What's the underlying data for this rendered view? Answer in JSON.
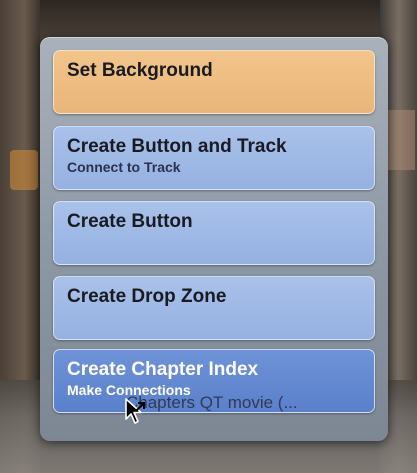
{
  "menu": {
    "items": [
      {
        "title": "Set Background",
        "subtitle": ""
      },
      {
        "title": "Create Button and Track",
        "subtitle": "Connect to Track"
      },
      {
        "title": "Create Button",
        "subtitle": ""
      },
      {
        "title": "Create Drop Zone",
        "subtitle": ""
      },
      {
        "title": "Create Chapter Index",
        "subtitle": "Make Connections"
      }
    ]
  },
  "drag": {
    "label": "Chapters QT movie (..."
  },
  "icons": {
    "cursor": "drag-copy-cursor-icon"
  },
  "colors": {
    "highlight": "#5a80cb",
    "background_item": "#e9b57a",
    "item": "#96b1e1"
  }
}
